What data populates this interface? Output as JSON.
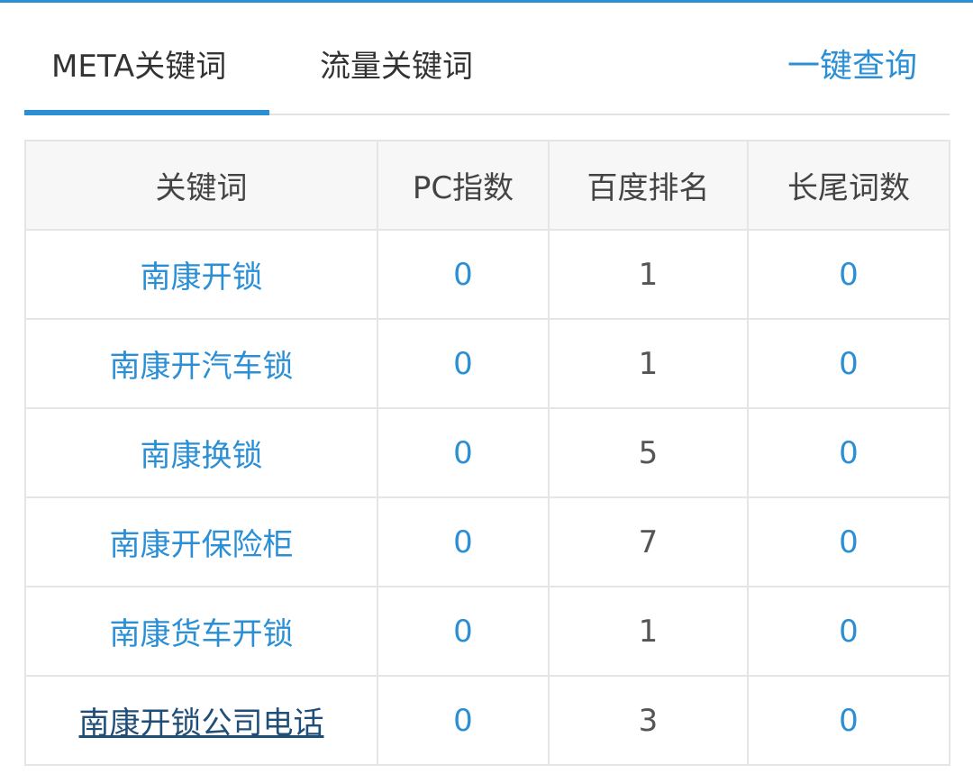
{
  "tabs": [
    {
      "label": "META关键词",
      "active": true
    },
    {
      "label": "流量关键词",
      "active": false
    }
  ],
  "query_link": "一键查询",
  "table": {
    "headers": [
      "关键词",
      "PC指数",
      "百度排名",
      "长尾词数"
    ],
    "rows": [
      {
        "keyword": "南康开锁",
        "pc_index": "0",
        "baidu_rank": "1",
        "long_tail": "0"
      },
      {
        "keyword": "南康开汽车锁",
        "pc_index": "0",
        "baidu_rank": "1",
        "long_tail": "0"
      },
      {
        "keyword": "南康换锁",
        "pc_index": "0",
        "baidu_rank": "5",
        "long_tail": "0"
      },
      {
        "keyword": "南康开保险柜",
        "pc_index": "0",
        "baidu_rank": "7",
        "long_tail": "0"
      },
      {
        "keyword": "南康货车开锁",
        "pc_index": "0",
        "baidu_rank": "1",
        "long_tail": "0"
      },
      {
        "keyword": "南康开锁公司电话",
        "pc_index": "0",
        "baidu_rank": "3",
        "long_tail": "0"
      }
    ]
  },
  "colors": {
    "accent": "#2b8fd6",
    "visited_link": "#1f4e79"
  }
}
